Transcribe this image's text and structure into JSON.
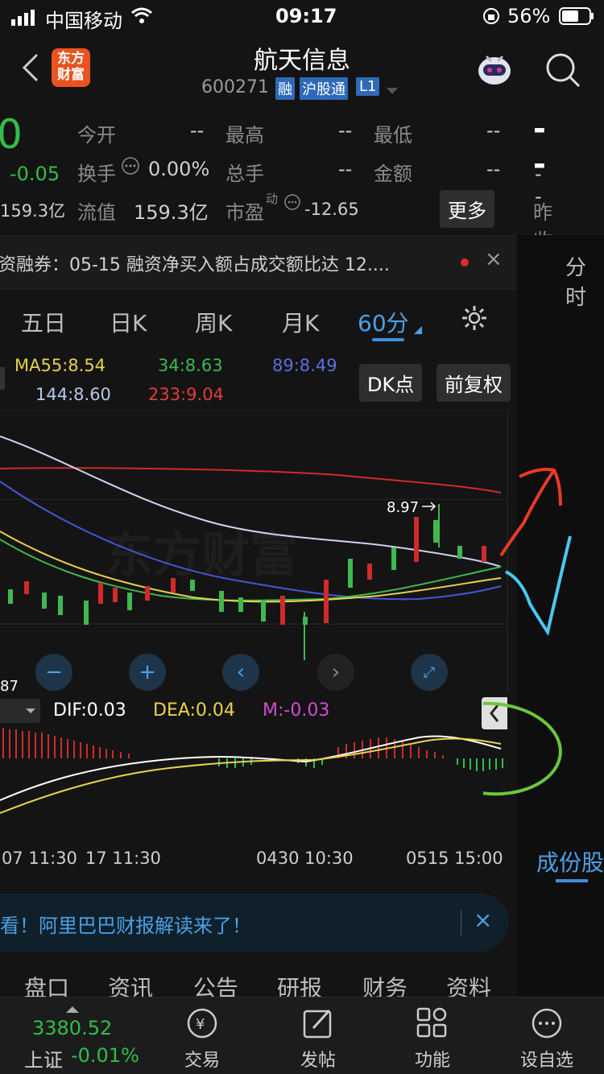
{
  "status": {
    "carrier": "中国移动",
    "time": "09:17",
    "battery": "56%"
  },
  "nav": {
    "title": "航天信息",
    "code": "600271",
    "badges": [
      "融",
      "沪股通",
      "L1"
    ],
    "logo_line1": "东方",
    "logo_line2": "财富"
  },
  "quote": {
    "price": "0",
    "change": "-0.05",
    "cap_left": "159.3亿",
    "labels": {
      "open": "今开",
      "high": "最高",
      "low": "最低",
      "turnover": "换手",
      "total_hands": "总手",
      "amount": "金额",
      "float_val": "流值",
      "pe": "市盈",
      "pe_sup": "动",
      "prev_close": "昨收"
    },
    "values": {
      "open": "--",
      "high": "--",
      "low": "--",
      "turnover": "0.00%",
      "total_hands": "--",
      "amount": "--",
      "float_val": "159.3亿",
      "pe": "-12.65",
      "big_dash": "--",
      "small_dash": "--"
    },
    "more": "更多"
  },
  "news": {
    "text": "资融券：05-15 融资净买入额占成交额比达 12....",
    "close": "×"
  },
  "right_strip": {
    "tab": "分时",
    "component": "成份股"
  },
  "tabs": [
    "五日",
    "日K",
    "周K",
    "月K",
    "60分"
  ],
  "ma": {
    "ma55": "MA55:8.54",
    "ma34": "34:8.63",
    "ma89": "89:8.49",
    "ma144": "144:8.60",
    "ma233": "233:9.04",
    "dk": "DK点",
    "fq": "前复权"
  },
  "chart": {
    "max_label": "8.97",
    "min_label": "87",
    "watermark": "东方财富"
  },
  "macd": {
    "dif": "DIF:0.03",
    "dea": "DEA:0.04",
    "m": "M:-0.03"
  },
  "xaxis": [
    "07 11:30",
    "17 11:30",
    "0430 10:30",
    "0515 15:00"
  ],
  "ad": {
    "text": "看！阿里巴巴财报解读来了！",
    "close": "×"
  },
  "bottom_tabs": [
    "盘口",
    "资讯",
    "公告",
    "研报",
    "财务",
    "资料"
  ],
  "footer": {
    "index_value": "3380.52",
    "index_name": "上证",
    "index_change": "-0.01%",
    "items": [
      "交易",
      "发帖",
      "功能",
      "设自选"
    ]
  },
  "colors": {
    "up": "#e23c3c",
    "down": "#2fbf4a",
    "accent": "#3d8fe0",
    "bg": "#141414"
  }
}
